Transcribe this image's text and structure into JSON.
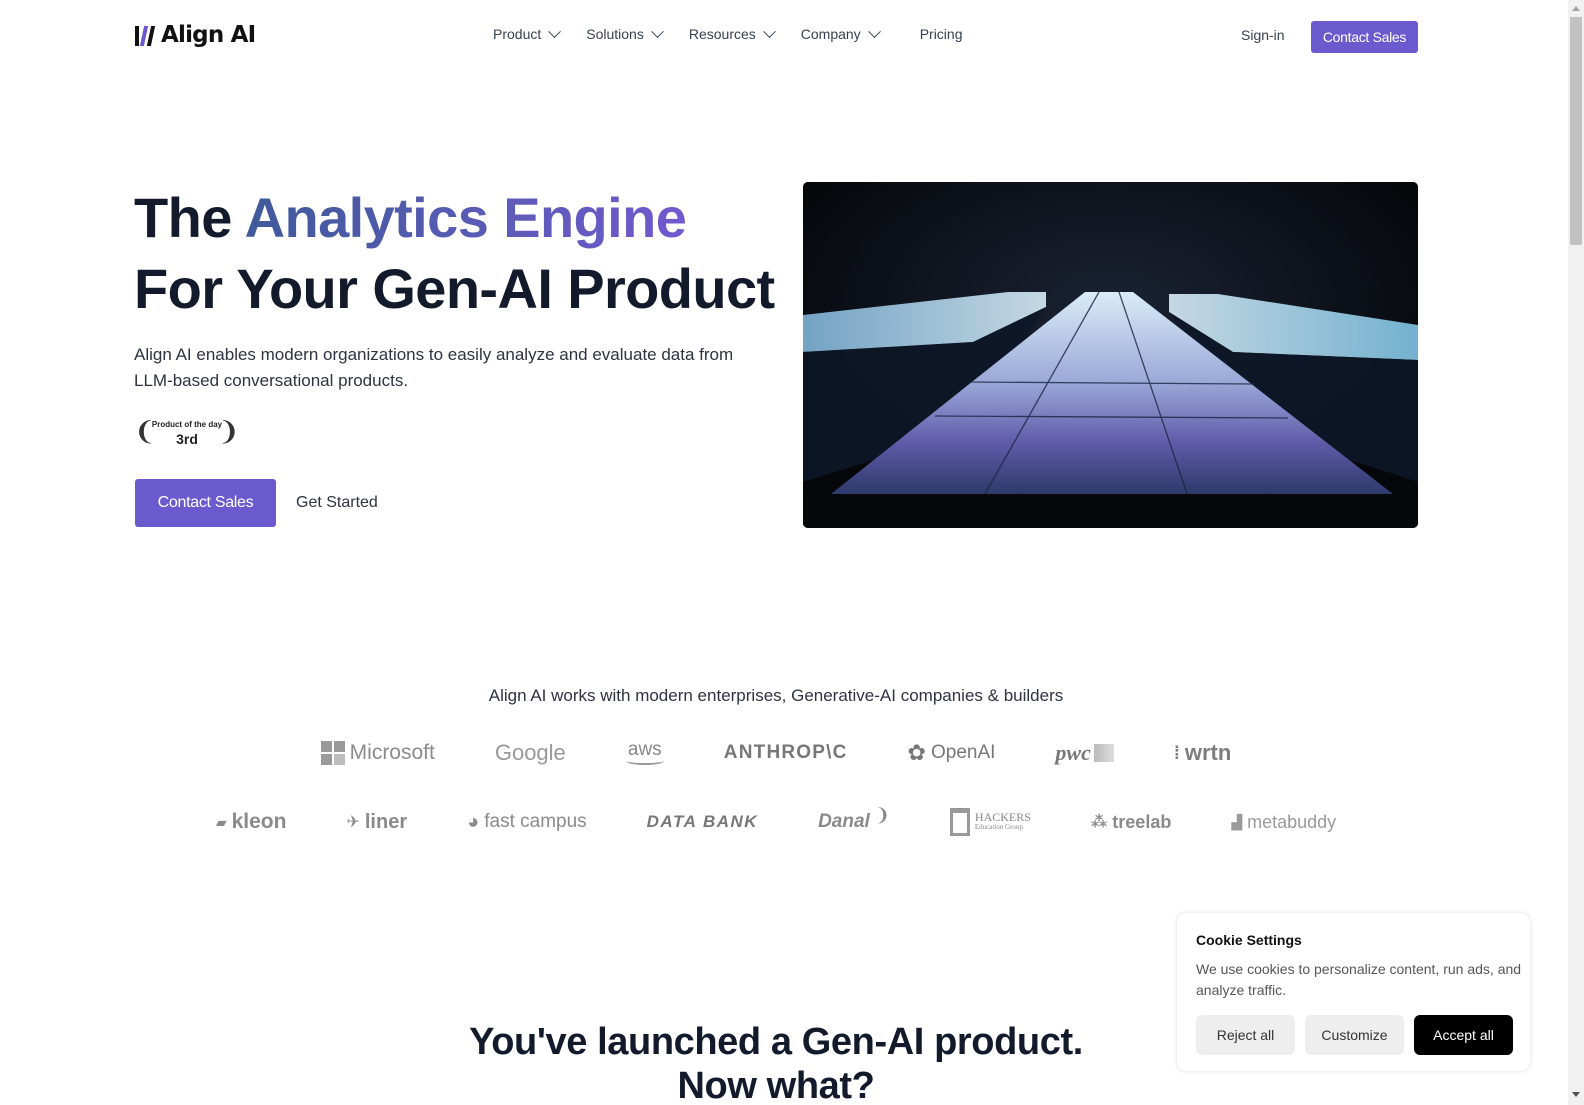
{
  "header": {
    "brand": "Align AI",
    "nav": [
      {
        "label": "Product",
        "has_dropdown": true
      },
      {
        "label": "Solutions",
        "has_dropdown": true
      },
      {
        "label": "Resources",
        "has_dropdown": true
      },
      {
        "label": "Company",
        "has_dropdown": true
      },
      {
        "label": "Pricing",
        "has_dropdown": false
      }
    ],
    "signin_label": "Sign-in",
    "contact_label": "Contact Sales"
  },
  "hero": {
    "title_prefix": "The ",
    "title_highlight": "Analytics Engine",
    "title_line2": "For Your Gen-AI Product",
    "subtitle": "Align AI enables modern organizations to easily analyze and evaluate data from LLM-based conversational products.",
    "badge": {
      "small": "Product of the day",
      "big": "3rd"
    },
    "primary_cta": "Contact Sales",
    "secondary_cta": "Get Started",
    "visual": "3d-tiled-pathway-illustration"
  },
  "customers": {
    "heading": "Align AI works with modern enterprises, Generative-AI companies & builders",
    "row1": [
      "Microsoft",
      "Google",
      "aws",
      "ANTHROP\\C",
      "OpenAI",
      "pwc",
      "wrtn"
    ],
    "row2": [
      "kleon",
      "liner",
      "fast campus",
      "DATA BANK",
      "Danal",
      "HACKERS",
      "Education Group",
      "treelab",
      "metabuddy"
    ]
  },
  "section": {
    "title_line1": "You've launched a Gen-AI product.",
    "title_line2": "Now what?"
  },
  "cookie": {
    "title": "Cookie Settings",
    "body": "We use cookies to personalize content, run ads, and analyze traffic.",
    "reject": "Reject all",
    "customize": "Customize",
    "accept": "Accept all"
  },
  "colors": {
    "accent": "#6b5acd",
    "heading": "#131a2b",
    "gradient_start": "#3f5a9a",
    "gradient_end": "#7059cf"
  }
}
